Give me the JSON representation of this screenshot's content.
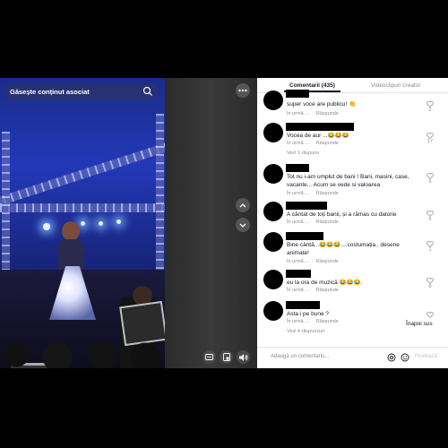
{
  "video": {
    "search_placeholder": "Găsește conținut asociat"
  },
  "panel": {
    "tabs": [
      {
        "label": "Comentarii (435)",
        "active": true
      },
      {
        "label": "Videoclipuri creator",
        "active": false
      }
    ],
    "meta_labels": {
      "time": "În urmă ...",
      "reply": "Răspunde"
    },
    "comments": [
      {
        "text": "super voce are publicu! 👏",
        "likes": "2",
        "replies": ""
      },
      {
        "text": "Vocea de aur ...😂😂😂",
        "likes": "17",
        "replies": "Vezi 1 răspuns"
      },
      {
        "text": "Tot nu i-am umplut de bani ! Bani, masini, case, vacante... Acum se vede si valoarea",
        "likes": "6",
        "replies": ""
      },
      {
        "text": "A cântat de toți banii, și a rămas cu datorie",
        "likes": "6",
        "replies": ""
      },
      {
        "text": "Bine cântă...😂😂😂....costumația.. desene animate!",
        "likes": "1",
        "replies": ""
      },
      {
        "text": "eu la ora de muzică 😂😂😂.",
        "likes": "6",
        "replies": ""
      },
      {
        "text": "Asta i pe bune ?",
        "likes": "",
        "replies": "Vezi 4 răspunsuri"
      }
    ],
    "back_up": "Înapoi sus",
    "add_comment_placeholder": "Adaugă un comentariu...",
    "post_label": "Postează"
  },
  "icons": {
    "search": "search-icon",
    "more": "more-icon",
    "chevron_up": "chevron-up-icon",
    "chevron_down": "chevron-down-icon",
    "captions": "captions-icon",
    "pip": "floating-player-icon",
    "volume": "volume-icon",
    "at": "mention-icon",
    "emoji": "emoji-icon",
    "like": "heart-icon"
  }
}
